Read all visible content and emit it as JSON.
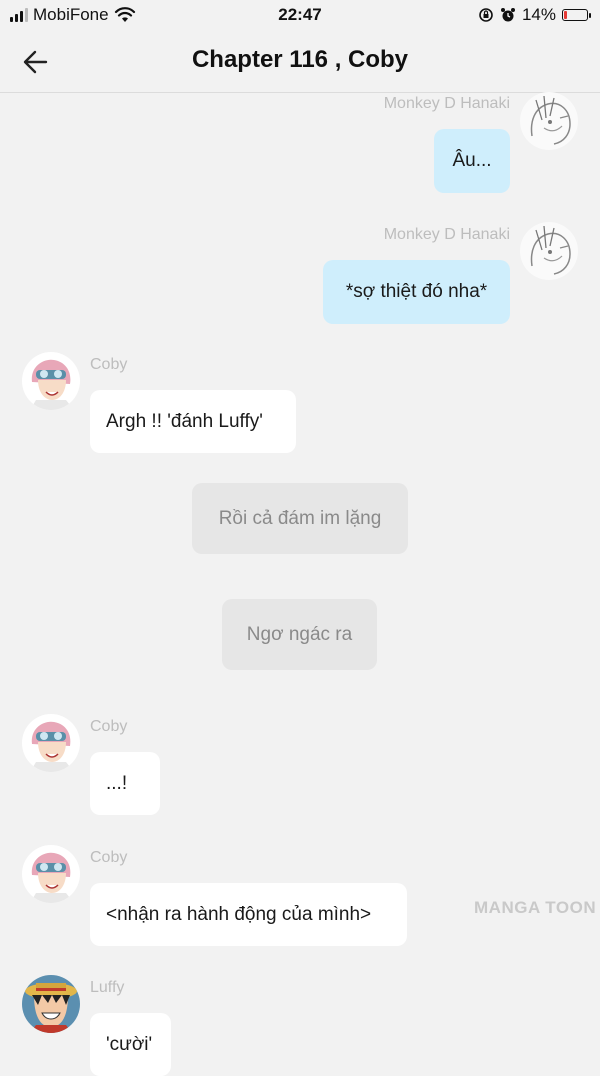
{
  "status_bar": {
    "carrier": "MobiFone",
    "time": "22:47",
    "battery": "14%",
    "battery_level": 0.14,
    "icons": [
      "signal-icon",
      "wifi-icon",
      "orientation-lock-icon",
      "alarm-icon",
      "battery-icon"
    ]
  },
  "header": {
    "title": "Chapter 116 , Coby",
    "back_icon": "arrow-left-icon"
  },
  "messages": [
    {
      "sender": "Monkey D Hanaki",
      "text": "Âu...",
      "side": "right"
    },
    {
      "sender": "Monkey D Hanaki",
      "text": "*sợ thiệt đó nha*",
      "side": "right"
    },
    {
      "sender": "Coby",
      "text": "Argh !! 'đánh Luffy'",
      "side": "left"
    },
    {
      "narration": "Rồi cả đám im lặng"
    },
    {
      "narration": "Ngơ ngác ra"
    },
    {
      "sender": "Coby",
      "text": "...!",
      "side": "left"
    },
    {
      "sender": "Coby",
      "text": "<nhận ra hành động của mình>",
      "side": "left"
    },
    {
      "sender": "Luffy",
      "text": "'cười'",
      "side": "left"
    }
  ],
  "watermark": "MANGA TOON",
  "colors": {
    "background": "#f2f2f2",
    "right_bubble": "#cfeefc",
    "left_bubble": "#ffffff",
    "narration_bubble": "#e6e6e6",
    "sender_name": "#bdbdbd"
  }
}
